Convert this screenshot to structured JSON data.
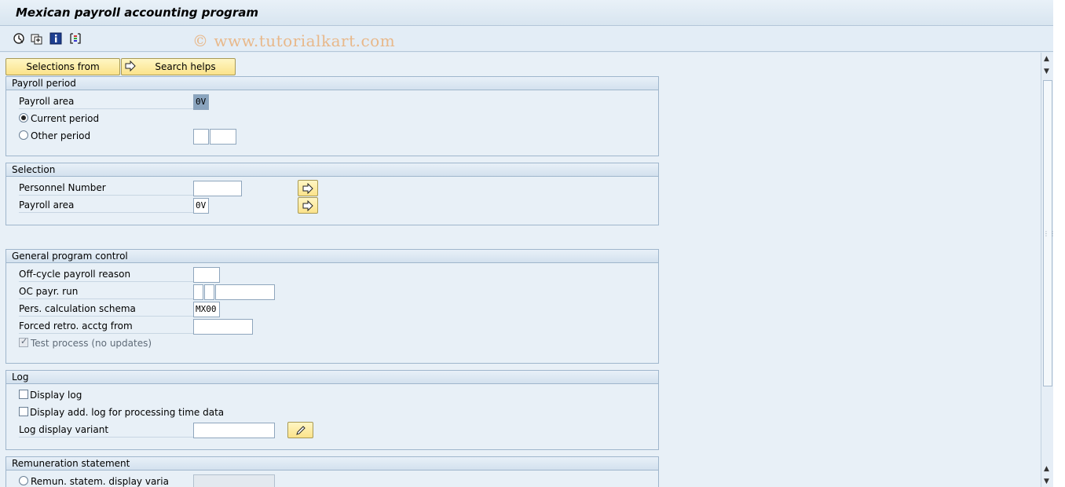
{
  "window": {
    "title": "Mexican payroll accounting program"
  },
  "toolbar": {
    "icons": [
      "execute-icon",
      "get-variant-icon",
      "program-info-icon",
      "selection-options-icon"
    ],
    "watermark": "© www.tutorialkart.com"
  },
  "buttons": {
    "selections_from": "Selections from",
    "search_helps": "Search helps"
  },
  "payroll_period": {
    "title": "Payroll period",
    "payroll_area_label": "Payroll area",
    "payroll_area_value": "0V",
    "current_period_label": "Current period",
    "current_period_selected": true,
    "other_period_label": "Other period",
    "other_period_selected": false
  },
  "selection": {
    "title": "Selection",
    "personnel_number_label": "Personnel Number",
    "personnel_number_value": "",
    "payroll_area_label": "Payroll area",
    "payroll_area_value": "0V"
  },
  "general_program_control": {
    "title": "General program control",
    "offcycle_reason_label": "Off-cycle payroll reason",
    "oc_payr_run_label": "OC payr. run",
    "schema_label": "Pers. calculation schema",
    "schema_value": "MX00",
    "forced_retro_label": "Forced retro. acctg from",
    "test_process_label": "Test process (no updates)",
    "test_process_checked": true
  },
  "log": {
    "title": "Log",
    "display_log_label": "Display log",
    "display_add_log_label": "Display add. log for processing time data",
    "log_variant_label": "Log display variant"
  },
  "remuneration": {
    "title": "Remuneration statement",
    "display_variant_label": "Remun. statem. display varia"
  }
}
